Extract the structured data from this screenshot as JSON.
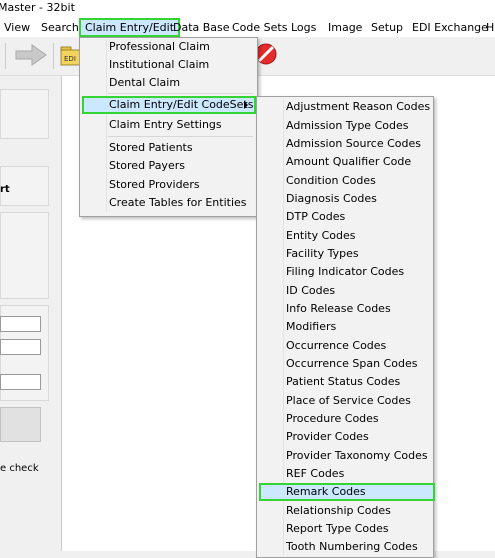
{
  "window": {
    "title": "Master - 32bit"
  },
  "menubar": {
    "items": [
      "View",
      "Search",
      "Claim Entry/Edit",
      "Data Base",
      "Code Sets",
      "Logs",
      "Image",
      "Setup",
      "EDI Exchange",
      "H"
    ]
  },
  "left_pane": {
    "label_1": "rt",
    "label_2": "e check"
  },
  "claim_menu": {
    "items": [
      "Professional Claim",
      "Institutional Claim",
      "Dental Claim",
      "Claim Entry/Edit CodeSets",
      "Claim Entry Settings",
      "Stored Patients",
      "Stored Payers",
      "Stored Providers",
      "Create Tables for Entities"
    ]
  },
  "codesets_menu": {
    "items": [
      "Adjustment Reason Codes",
      "Admission Type Codes",
      "Admission Source Codes",
      "Amount Qualifier Code",
      "Condition Codes",
      "Diagnosis Codes",
      "DTP Codes",
      "Entity Codes",
      "Facility Types",
      "Filing Indicator Codes",
      "ID Codes",
      "Info Release Codes",
      "Modifiers",
      "Occurrence Codes",
      "Occurrence Span Codes",
      "Patient Status Codes",
      "Place of Service Codes",
      "Procedure Codes",
      "Provider Codes",
      "Provider Taxonomy Codes",
      "REF Codes",
      "Remark Codes",
      "Relationship Codes",
      "Report Type Codes",
      "Tooth Numbering Codes"
    ]
  },
  "colors": {
    "highlight": "#cce8ff",
    "focus_border": "#35d435"
  }
}
